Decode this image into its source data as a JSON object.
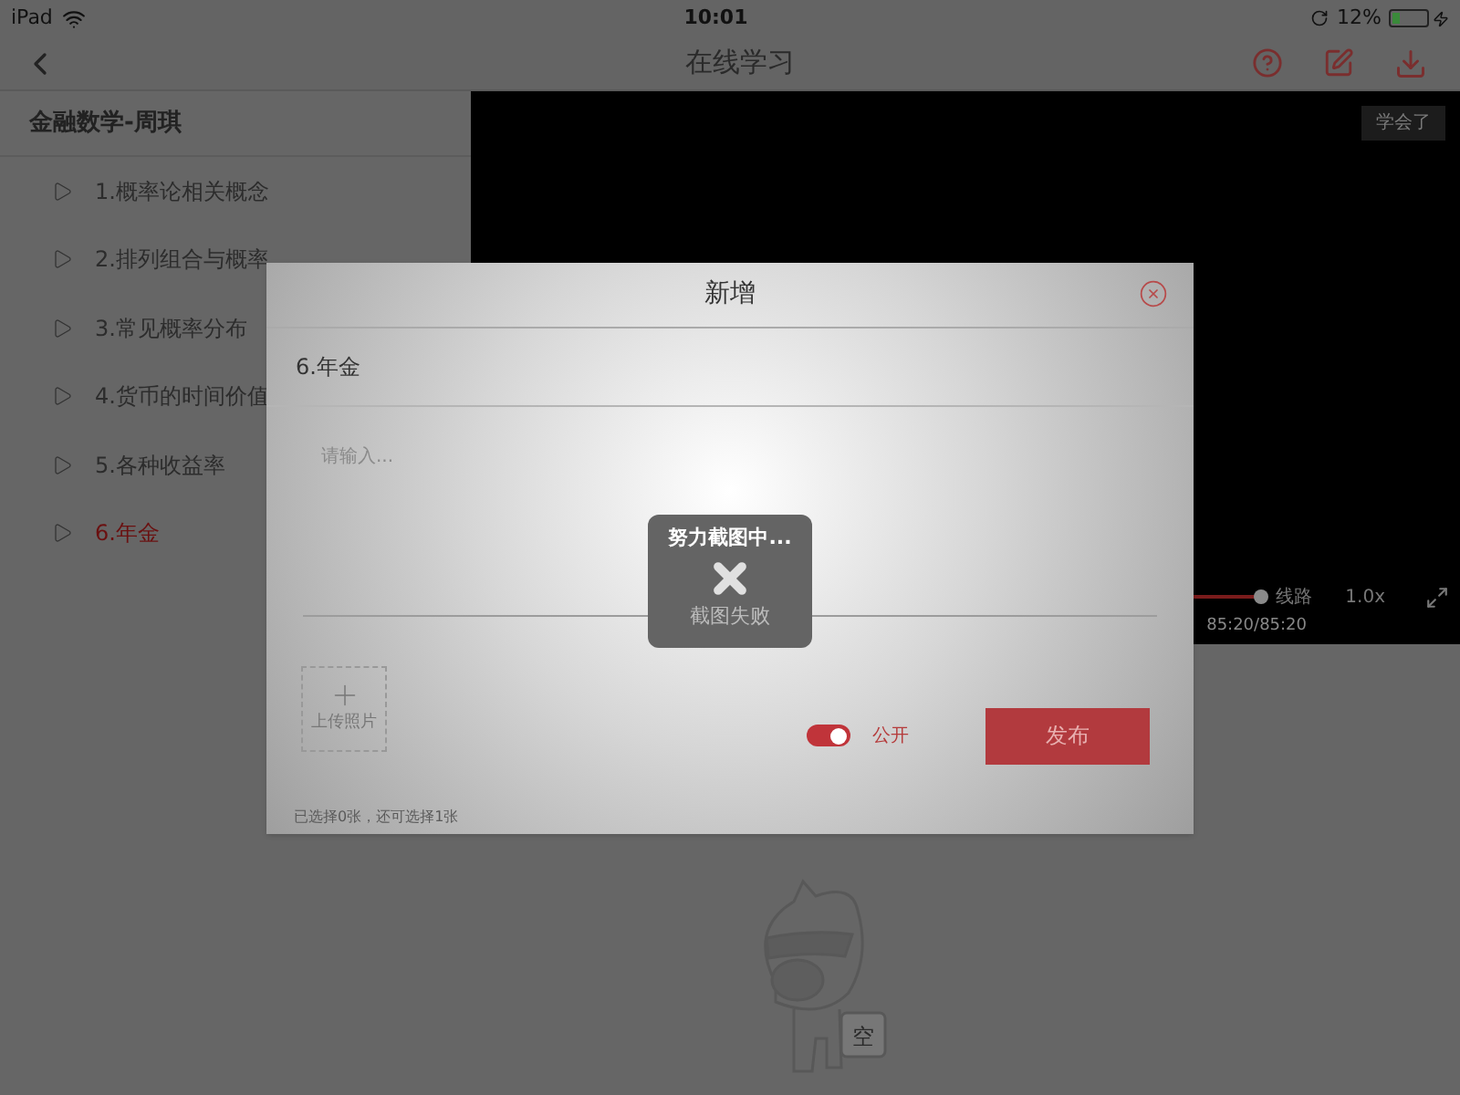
{
  "status_bar": {
    "device": "iPad",
    "time": "10:01",
    "battery": "12%"
  },
  "nav": {
    "title": "在线学习"
  },
  "sidebar": {
    "title": "金融数学-周琪",
    "items": [
      {
        "label": "1.概率论相关概念",
        "selected": false
      },
      {
        "label": "2.排列组合与概率",
        "selected": false
      },
      {
        "label": "3.常见概率分布",
        "selected": false
      },
      {
        "label": "4.货币的时间价值",
        "selected": false
      },
      {
        "label": "5.各种收益率",
        "selected": false
      },
      {
        "label": "6.年金",
        "selected": true
      }
    ]
  },
  "video": {
    "learned_button": "学会了",
    "progress": {
      "level": 1
    },
    "time": "85:20/85:20",
    "line_button": "线路",
    "speed": "1.0x"
  },
  "dialog": {
    "title": "新增",
    "lesson": "6.年金",
    "placeholder": "请输入...",
    "upload_label": "上传照片",
    "public_toggle": {
      "label": "公开",
      "on": true
    },
    "publish_button": "发布",
    "hint": "已选择0张，还可选择1张"
  },
  "toast": {
    "title": "努力截图中...",
    "message": "截图失败"
  },
  "empty_state": {
    "bag_label": "空"
  }
}
